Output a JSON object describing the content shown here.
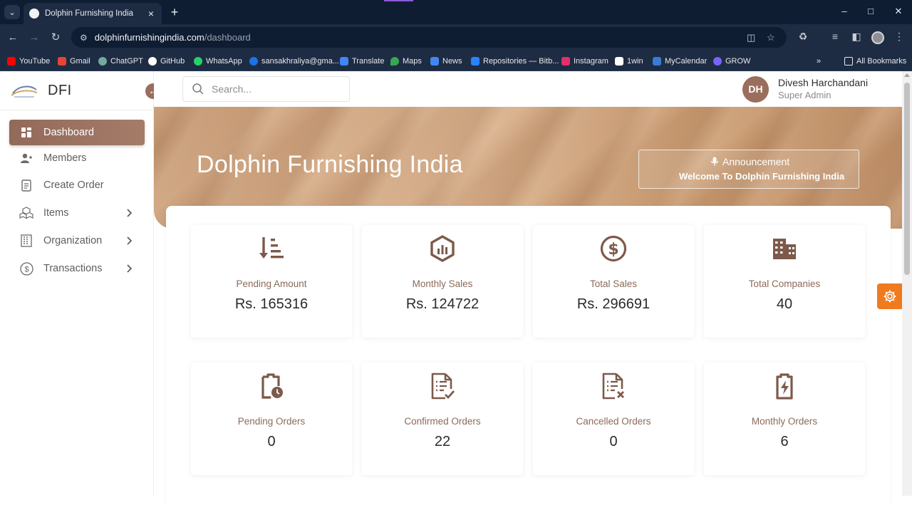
{
  "browser": {
    "tab_title": "Dolphin Furnishing India",
    "url_host": "dolphinfurnishingindia.com",
    "url_path": "/dashboard",
    "bookmarks": [
      {
        "label": "YouTube",
        "color": "#ff0000"
      },
      {
        "label": "Gmail",
        "color": "#ea4335"
      },
      {
        "label": "ChatGPT",
        "color": "#74aa9c"
      },
      {
        "label": "GitHub",
        "color": "#ffffff"
      },
      {
        "label": "WhatsApp",
        "color": "#25d366"
      },
      {
        "label": "sansakhraliya@gma...",
        "color": "#1a73e8"
      },
      {
        "label": "Translate",
        "color": "#4285f4"
      },
      {
        "label": "Maps",
        "color": "#34a853"
      },
      {
        "label": "News",
        "color": "#4285f4"
      },
      {
        "label": "Repositories — Bitb...",
        "color": "#2684ff"
      },
      {
        "label": "Instagram",
        "color": "#e1306c"
      },
      {
        "label": "1win",
        "color": "#ffffff"
      },
      {
        "label": "MyCalendar",
        "color": "#3a7bd5"
      },
      {
        "label": "GROW",
        "color": "#7b61ff"
      }
    ],
    "all_bookmarks": "All Bookmarks"
  },
  "brand": {
    "name": "DFI"
  },
  "sidebar": {
    "items": [
      {
        "label": "Dashboard",
        "icon": "dashboard-icon"
      },
      {
        "label": "Members",
        "icon": "members-icon"
      },
      {
        "label": "Create Order",
        "icon": "document-icon"
      },
      {
        "label": "Items",
        "icon": "boxes-icon"
      },
      {
        "label": "Organization",
        "icon": "building-icon"
      },
      {
        "label": "Transactions",
        "icon": "dollar-circle-icon"
      }
    ]
  },
  "search": {
    "placeholder": "Search..."
  },
  "user": {
    "initials": "DH",
    "name": "Divesh Harchandani",
    "role": "Super Admin"
  },
  "hero": {
    "title": "Dolphin Furnishing India",
    "announcement_title": "Announcement",
    "announcement_text": "Welcome To Dolphin Furnishing India"
  },
  "stats": [
    {
      "label": "Pending Amount",
      "value": "Rs. 165316",
      "icon": "sort-descending-icon"
    },
    {
      "label": "Monthly Sales",
      "value": "Rs. 124722",
      "icon": "hexagon-chart-icon"
    },
    {
      "label": "Total Sales",
      "value": "Rs. 296691",
      "icon": "dollar-circle-icon"
    },
    {
      "label": "Total Companies",
      "value": "40",
      "icon": "building-icon"
    },
    {
      "label": "Pending Orders",
      "value": "0",
      "icon": "clipboard-clock-icon"
    },
    {
      "label": "Confirmed Orders",
      "value": "22",
      "icon": "file-check-icon"
    },
    {
      "label": "Cancelled Orders",
      "value": "0",
      "icon": "file-x-icon"
    },
    {
      "label": "Monthly Orders",
      "value": "6",
      "icon": "clipboard-bolt-icon"
    }
  ],
  "colors": {
    "accent": "#9a6e5c",
    "icon": "#7d5a4b",
    "label": "#8b6a5a",
    "fab": "#f07a1e"
  }
}
